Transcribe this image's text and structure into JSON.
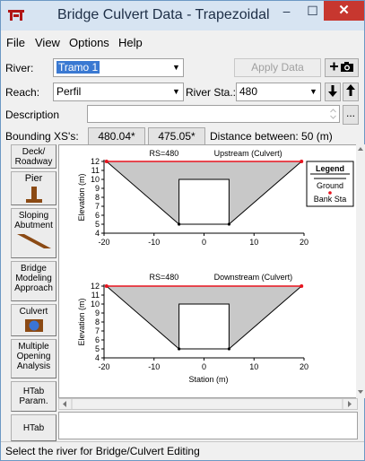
{
  "window": {
    "title": "Bridge Culvert Data - Trapezoidal"
  },
  "titlebar_buttons": {
    "minimize": "–",
    "maximize": "☐",
    "close": "✕"
  },
  "menu": {
    "file": "File",
    "view": "View",
    "options": "Options",
    "help": "Help"
  },
  "river": {
    "label": "River:",
    "value": "Tramo 1"
  },
  "apply_data_button": "Apply Data",
  "reach": {
    "label": "Reach:",
    "value": "Perfil"
  },
  "river_sta": {
    "label": "River Sta.:",
    "value": "480"
  },
  "description": {
    "label": "Description",
    "value": ""
  },
  "ellipsis_button": "...",
  "bounding": {
    "label": "Bounding XS's:",
    "upstream_value": "480.04*",
    "downstream_value": "475.05*",
    "distance_text": "Distance between: 50 (m)"
  },
  "sidebar": {
    "deck_roadway": "Deck/ Roadway",
    "pier": "Pier",
    "sloping_abutment": "Sloping Abutment",
    "bridge_modeling_approach": "Bridge Modeling Approach",
    "culvert": "Culvert",
    "multiple_opening_analysis": "Multiple Opening Analysis",
    "htab_param": "HTab Param.",
    "htab": "HTab"
  },
  "status_text": "Select the river for Bridge/Culvert Editing",
  "colors": {
    "ground_fill": "#c8c8c8",
    "bank_sta": "#e8141e",
    "culvert_box": "#ffffff"
  },
  "chart_data": [
    {
      "type": "area",
      "title_left": "RS=480",
      "title_right": "Upstream  (Culvert)",
      "ylabel": "Elevation (m)",
      "xlabel": "",
      "xlim": [
        -20,
        20
      ],
      "ylim": [
        4,
        12
      ],
      "xticks": [
        "-20",
        "-10",
        "0",
        "10",
        "20"
      ],
      "yticks": [
        "4",
        "5",
        "6",
        "7",
        "8",
        "9",
        "10",
        "11",
        "12"
      ],
      "ground": {
        "x": [
          -19.5,
          -5,
          5,
          19.5
        ],
        "y": [
          12,
          5,
          5,
          12
        ]
      },
      "culvert": {
        "x": [
          -5,
          5
        ],
        "y_bottom": 5,
        "y_top": 10
      },
      "bank_sta": [
        {
          "x": -19.5,
          "y": 12
        },
        {
          "x": 19.5,
          "y": 12
        }
      ],
      "legend": {
        "title": "Legend",
        "entries": [
          "Ground",
          "Bank Sta"
        ],
        "placement": "top-right"
      }
    },
    {
      "type": "area",
      "title_left": "RS=480",
      "title_right": "Downstream  (Culvert)",
      "ylabel": "Elevation (m)",
      "xlabel": "Station (m)",
      "xlim": [
        -20,
        20
      ],
      "ylim": [
        4,
        12
      ],
      "xticks": [
        "-20",
        "-10",
        "0",
        "10",
        "20"
      ],
      "yticks": [
        "4",
        "5",
        "6",
        "7",
        "8",
        "9",
        "10",
        "11",
        "12"
      ],
      "ground": {
        "x": [
          -19.5,
          -5,
          5,
          19.5
        ],
        "y": [
          12,
          5,
          5,
          12
        ]
      },
      "culvert": {
        "x": [
          -5,
          5
        ],
        "y_bottom": 5,
        "y_top": 10
      },
      "bank_sta": [
        {
          "x": -19.5,
          "y": 12
        },
        {
          "x": 19.5,
          "y": 12
        }
      ]
    }
  ]
}
